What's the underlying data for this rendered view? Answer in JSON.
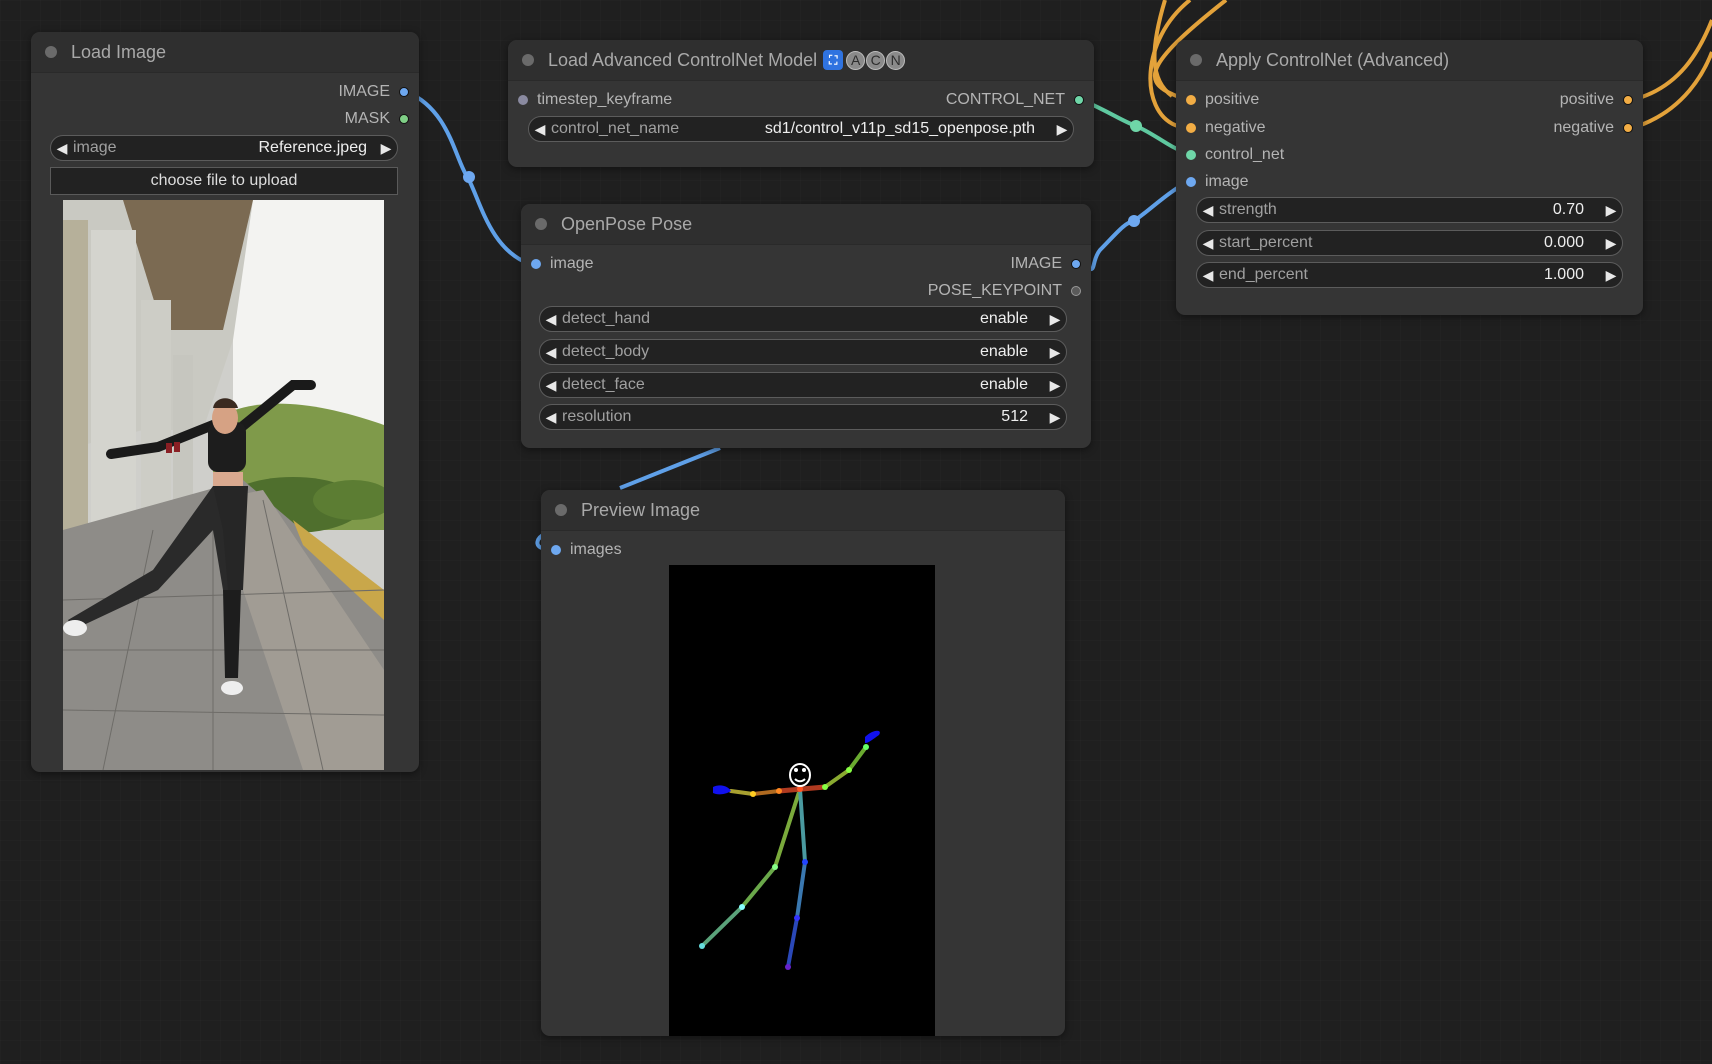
{
  "app": {
    "name": "ComfyUI node graph"
  },
  "colors": {
    "image_socket": "#6ea8f0",
    "mask_socket": "#7fcf86",
    "controlnet_socket": "#6fd6a8",
    "conditioning_socket": "#f2ad45",
    "keyframe_socket": "#8a8aa0",
    "pose_keypoint_socket": "#6a6a6a",
    "image_link": "#5fa0e8",
    "controlnet_link": "#5fc9a0",
    "conditioning_link": "#e3a23a"
  },
  "nodes": {
    "load_image": {
      "title": "Load Image",
      "outputs": [
        {
          "label": "IMAGE",
          "type": "image"
        },
        {
          "label": "MASK",
          "type": "mask"
        }
      ],
      "widget": {
        "label": "image",
        "value": "Reference.jpeg"
      },
      "upload_label": "choose file to upload",
      "preview": "photo of a woman in black crop top and leather pants dancing on a stone walkway with one leg raised and arms extended"
    },
    "load_controlnet": {
      "title": "Load Advanced ControlNet Model",
      "badges": [
        "A",
        "C",
        "N"
      ],
      "inputs": [
        {
          "label": "timestep_keyframe",
          "type": "keyframe"
        }
      ],
      "outputs": [
        {
          "label": "CONTROL_NET",
          "type": "controlnet"
        }
      ],
      "widget": {
        "label": "control_net_name",
        "value": "sd1/control_v11p_sd15_openpose.pth"
      }
    },
    "openpose": {
      "title": "OpenPose Pose",
      "inputs": [
        {
          "label": "image",
          "type": "image"
        }
      ],
      "outputs": [
        {
          "label": "IMAGE",
          "type": "image"
        },
        {
          "label": "POSE_KEYPOINT",
          "type": "pose_keypoint"
        }
      ],
      "widgets": [
        {
          "label": "detect_hand",
          "value": "enable"
        },
        {
          "label": "detect_body",
          "value": "enable"
        },
        {
          "label": "detect_face",
          "value": "enable"
        },
        {
          "label": "resolution",
          "value": "512"
        }
      ]
    },
    "apply_controlnet": {
      "title": "Apply ControlNet (Advanced)",
      "inputs": [
        {
          "label": "positive",
          "type": "conditioning"
        },
        {
          "label": "negative",
          "type": "conditioning"
        },
        {
          "label": "control_net",
          "type": "controlnet"
        },
        {
          "label": "image",
          "type": "image"
        }
      ],
      "outputs": [
        {
          "label": "positive",
          "type": "conditioning"
        },
        {
          "label": "negative",
          "type": "conditioning"
        }
      ],
      "widgets": [
        {
          "label": "strength",
          "value": "0.70"
        },
        {
          "label": "start_percent",
          "value": "0.000"
        },
        {
          "label": "end_percent",
          "value": "1.000"
        }
      ]
    },
    "preview_image": {
      "title": "Preview Image",
      "inputs": [
        {
          "label": "images",
          "type": "image"
        }
      ],
      "preview": "OpenPose skeleton rendering on black background"
    }
  }
}
